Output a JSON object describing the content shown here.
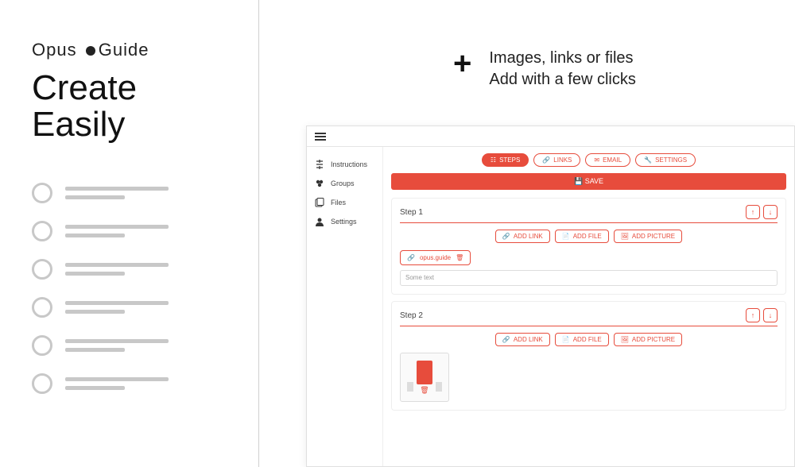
{
  "left": {
    "brand_a": "Opus",
    "brand_b": "Guide",
    "headline_1": "Create",
    "headline_2": "Easily"
  },
  "feature": {
    "line1": "Images, links or files",
    "line2": "Add with a few clicks"
  },
  "sidebar": {
    "items": [
      {
        "label": "Instructions"
      },
      {
        "label": "Groups"
      },
      {
        "label": "Files"
      },
      {
        "label": "Settings"
      }
    ]
  },
  "tabs": {
    "steps": "STEPS",
    "links": "LINKS",
    "email": "EMAIL",
    "settings": "SETTINGS"
  },
  "save_label": "SAVE",
  "step1": {
    "title": "Step 1",
    "add_link": "ADD LINK",
    "add_file": "ADD FILE",
    "add_picture": "ADD PICTURE",
    "chip_label": "opus.guide",
    "textarea": "Some text"
  },
  "step2": {
    "title": "Step 2",
    "add_link": "ADD LINK",
    "add_file": "ADD FILE",
    "add_picture": "ADD PICTURE"
  }
}
